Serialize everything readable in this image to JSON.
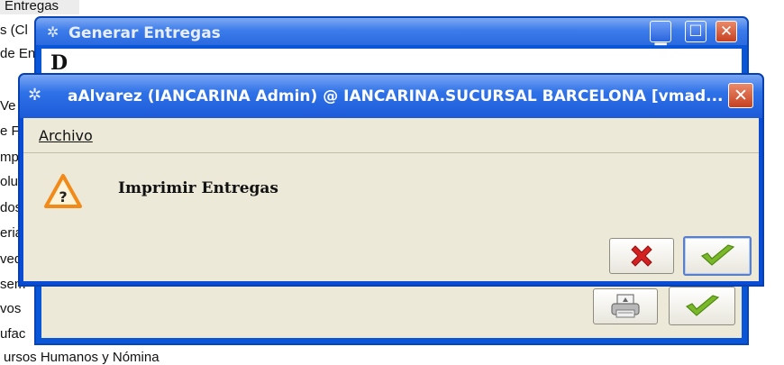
{
  "background_menu": {
    "items": [
      "Entregas",
      "s (Cl",
      "de En",
      "",
      "Ve",
      "e F",
      "mp",
      "olu",
      "dos",
      "eria",
      "ved",
      "sem",
      "vos",
      "ufac",
      "ursos Humanos y Nómina"
    ]
  },
  "back_window": {
    "title": "Generar Entregas",
    "icon": "gear-icon",
    "heading": "D",
    "controls": [
      "minimize-icon",
      "maximize-icon",
      "close-icon"
    ]
  },
  "dialog": {
    "title": "aAlvarez (IANCARINA Admin) @ IANCARINA.SUCURSAL BARCELONA [vmad...",
    "icon": "gear-icon",
    "menu": {
      "archivo": "Archivo"
    },
    "message": "Imprimir Entregas",
    "warning_icon": "question-warning-icon",
    "buttons": {
      "cancel": "cancel-x-icon",
      "ok": "ok-check-icon"
    }
  },
  "colors": {
    "titlebar": "#2f72e8",
    "dialog_bg": "#ece9d8",
    "cancel_red": "#d42020",
    "ok_green": "#7ab82a",
    "warning_orange": "#f28a1a"
  }
}
